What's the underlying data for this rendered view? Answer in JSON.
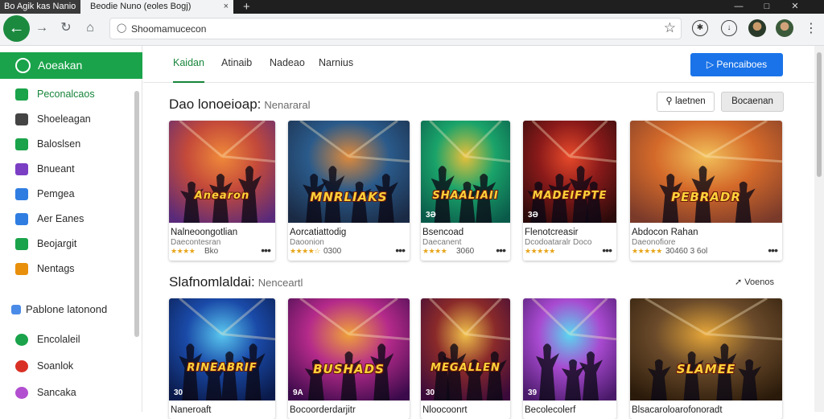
{
  "window": {
    "app_name": "Bo Agik kas Nanio",
    "tab_title": "Beodie Nuno (eoles Bogj)",
    "tab_close": "×",
    "new_tab": "+",
    "controls": [
      "—",
      "□",
      "✕"
    ]
  },
  "address_bar": {
    "url": "Shoomamucecon",
    "back_icon": "back-arrow-icon",
    "forward_icon": "forward-arrow-icon",
    "reload_icon": "reload-icon",
    "home_icon": "home-icon",
    "bookmark_icon": "star-icon"
  },
  "sidebar": {
    "brand": "Aoeakan",
    "items": [
      {
        "label": "Peconalcaos",
        "icon": "grid-icon",
        "color": "#1aa34a",
        "active": true
      },
      {
        "label": "Shoeleagan",
        "icon": "controller-icon",
        "color": "#444444",
        "active": false
      },
      {
        "label": "Baloslsen",
        "icon": "circle-icon",
        "color": "#1aa34a",
        "active": false
      },
      {
        "label": "Bnueant",
        "icon": "chart-icon",
        "color": "#7b3fc4",
        "active": false
      },
      {
        "label": "Pemgea",
        "icon": "square-icon",
        "color": "#2f7de1",
        "active": false
      },
      {
        "label": "Aer Eanes",
        "icon": "phone-icon",
        "color": "#2f7de1",
        "active": false
      },
      {
        "label": "Beojargit",
        "icon": "chat-icon",
        "color": "#1aa34a",
        "active": false
      },
      {
        "label": "Nentags",
        "icon": "tag-icon",
        "color": "#e8900c",
        "active": false
      }
    ],
    "section": "Pablone latonond",
    "section_items": [
      {
        "label": "Encolaleil",
        "icon": "whatsapp-icon",
        "color": "#1aa34a"
      },
      {
        "label": "Soanlok",
        "icon": "record-icon",
        "color": "#d93025"
      },
      {
        "label": "Sancaka",
        "icon": "drop-icon",
        "color": "#b24fd0"
      }
    ]
  },
  "tabs": [
    {
      "label": "Kaidan",
      "active": true
    },
    {
      "label": "Atinaib",
      "active": false
    },
    {
      "label": "Nadeao",
      "active": false
    },
    {
      "label": "Narnius",
      "active": false
    }
  ],
  "primary_button": "Pencaiboes",
  "section1": {
    "title": "Dao lonoeioap:",
    "subtitle": "Nenararal",
    "search_button": "laetnen",
    "filter_button": "Bocaenan"
  },
  "section2": {
    "title": "Slafnomlaldai:",
    "subtitle": "Nenceartl",
    "see_more": "Voenos"
  },
  "games_row1": [
    {
      "art_title": "Anearon",
      "badge": "",
      "name": "Nalneoongotlian",
      "meta": "Daecontesran",
      "stars": "★★★★",
      "rating": "Bko",
      "colors": [
        "#5a2a7a",
        "#c44a3a",
        "#f08a3a"
      ]
    },
    {
      "art_title": "MNRLIAKS",
      "badge": "",
      "name": "Aorcatiattodig",
      "meta": "Daoonion",
      "stars": "★★★★☆",
      "rating": "0300",
      "colors": [
        "#1a2a44",
        "#2a5a8a",
        "#e08a3a"
      ]
    },
    {
      "art_title": "SHAALIAII",
      "badge": "3Ə",
      "name": "Bsencoad",
      "meta": "Daecanent",
      "stars": "★★★★",
      "rating": "3060",
      "colors": [
        "#0a5a4a",
        "#1aa36a",
        "#e8c03a"
      ]
    },
    {
      "art_title": "MADEIFPTE",
      "badge": "3Ə",
      "name": "Flenotcreasir",
      "meta": "Dcodoataralr Doco",
      "stars": "★★★★★",
      "rating": "",
      "colors": [
        "#2a0a0a",
        "#8a1a1a",
        "#e84a2a"
      ]
    },
    {
      "art_title": "PEBRADR",
      "badge": "",
      "name": "Abdocon Rahan",
      "meta": "Daeonofiore",
      "stars": "★★★★★",
      "rating": "30460 3 6ol",
      "colors": [
        "#7a3a2a",
        "#d46a2a",
        "#f2c05a"
      ]
    }
  ],
  "games_row2": [
    {
      "art_title": "RINEABRIF",
      "badge": "30",
      "name": "Naneroaft",
      "colors": [
        "#0a1a4a",
        "#1a4aa8",
        "#5ac8f0"
      ]
    },
    {
      "art_title": "BUSHADS",
      "badge": "9A",
      "name": "Bocoorderdarjitr",
      "colors": [
        "#3a0a4a",
        "#b42a8a",
        "#f0a23a"
      ]
    },
    {
      "art_title": "MEGALLEN",
      "badge": "30",
      "name": "Nloocoonrt",
      "colors": [
        "#3a0a3a",
        "#8a2a2a",
        "#f0c04a"
      ]
    },
    {
      "art_title": "",
      "badge": "39",
      "name": "Becolecolerf",
      "colors": [
        "#4a1a6a",
        "#a84ad0",
        "#5ad8f0"
      ]
    },
    {
      "art_title": "SLAMEE",
      "badge": "",
      "name": "Blsacaroloarofonoradt",
      "colors": [
        "#2a1a0a",
        "#6a4a2a",
        "#e8a83a"
      ]
    }
  ]
}
